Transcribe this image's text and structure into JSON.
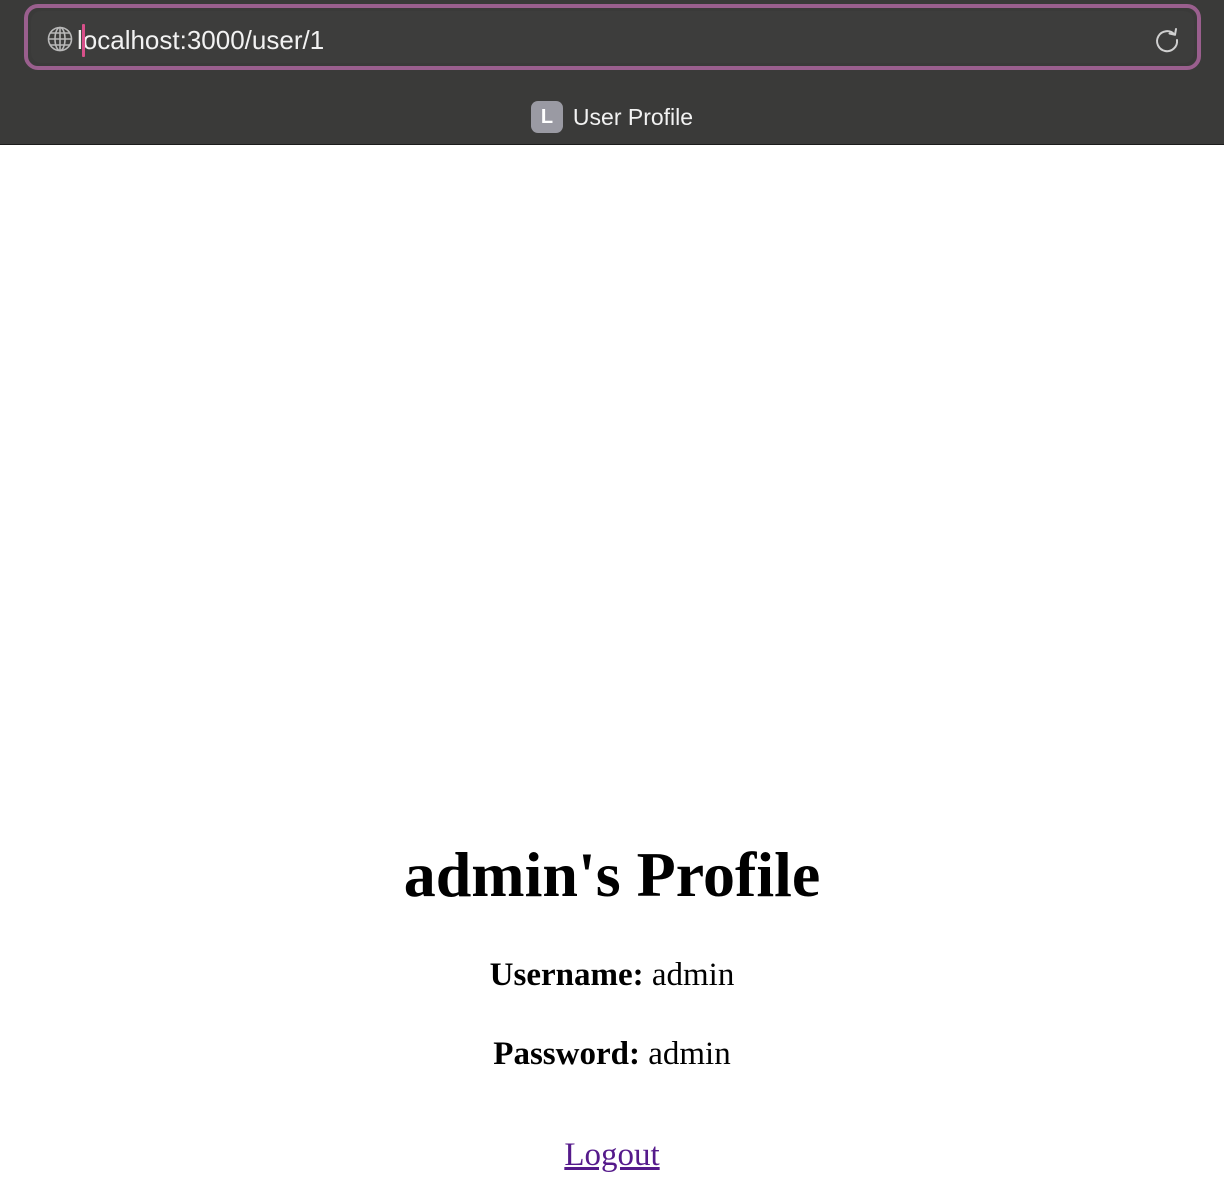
{
  "browser": {
    "url": "localhost:3000/user/1",
    "tab": {
      "favicon_letter": "L",
      "title": "User Profile"
    }
  },
  "page": {
    "heading": "admin's Profile",
    "username": {
      "label": "Username:",
      "value": "admin"
    },
    "password": {
      "label": "Password:",
      "value": "admin"
    },
    "logout_link": "Logout"
  },
  "colors": {
    "chrome_bg": "#3a3a39",
    "urlbar_focus_ring": "#9a5f8e",
    "caret": "#d8508a",
    "visited_link": "#551a8b"
  }
}
